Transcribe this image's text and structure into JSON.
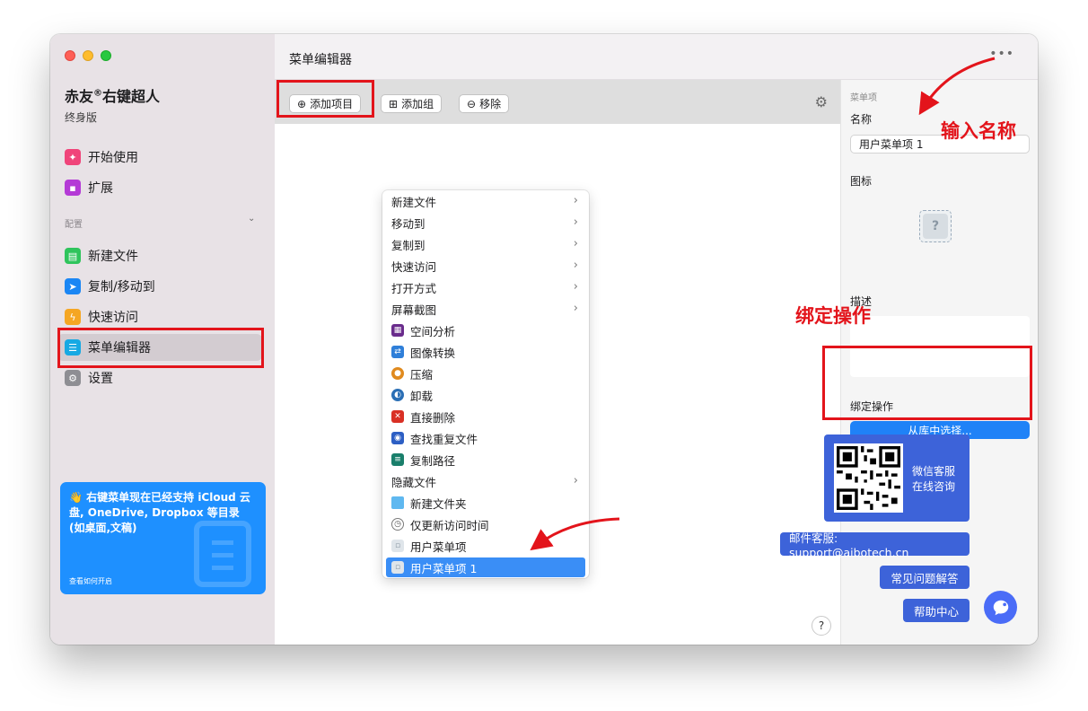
{
  "app": {
    "name": "赤友",
    "registered": "®",
    "name_suffix": "右键超人",
    "edition": "终身版"
  },
  "sidebar": {
    "top_items": [
      {
        "label": "开始使用",
        "icon": "bulb-icon",
        "color": "#f0447a"
      },
      {
        "label": "扩展",
        "icon": "puzzle-icon",
        "color": "#b43ad6"
      }
    ],
    "section_label": "配置",
    "items": [
      {
        "label": "新建文件",
        "icon": "new-file-icon",
        "color": "#2fc45c"
      },
      {
        "label": "复制/移动到",
        "icon": "send-icon",
        "color": "#1b86f4"
      },
      {
        "label": "快速访问",
        "icon": "bolt-icon",
        "color": "#f5a623"
      },
      {
        "label": "菜单编辑器",
        "icon": "list-icon",
        "color": "#17a9e3",
        "active": true
      },
      {
        "label": "设置",
        "icon": "gear-icon",
        "color": "#8e8e93"
      }
    ],
    "promo": {
      "emoji": "👋",
      "text": "右键菜单现在已经支持 iCloud 云盘, OneDrive, Dropbox 等目录 (如桌面,文稿)",
      "link": "查看如何开启"
    }
  },
  "header": {
    "title": "菜单编辑器",
    "more": "•••"
  },
  "toolbar": {
    "add_item": "添加项目",
    "add_group": "添加组",
    "remove": "移除"
  },
  "context_menu": {
    "items": [
      {
        "label": "新建文件",
        "submenu": true
      },
      {
        "label": "移动到",
        "submenu": true
      },
      {
        "label": "复制到",
        "submenu": true
      },
      {
        "label": "快速访问",
        "submenu": true
      },
      {
        "label": "打开方式",
        "submenu": true
      },
      {
        "label": "屏幕截图",
        "submenu": true
      },
      {
        "label": "空间分析",
        "icon": "disk-analyzer-icon",
        "color": "#6a2c8c"
      },
      {
        "label": "图像转换",
        "icon": "image-convert-icon",
        "color": "#2f7fd9"
      },
      {
        "label": "压缩",
        "icon": "archive-icon",
        "color": "#e08a1e"
      },
      {
        "label": "卸载",
        "icon": "uninstall-icon",
        "color": "#2b6fb5"
      },
      {
        "label": "直接删除",
        "icon": "delete-icon",
        "color": "#d93025"
      },
      {
        "label": "查找重复文件",
        "icon": "duplicate-finder-icon",
        "color": "#2d5fc4"
      },
      {
        "label": "复制路径",
        "icon": "copy-path-icon",
        "color": "#1a7f6b"
      },
      {
        "label": "隐藏文件",
        "submenu": true
      },
      {
        "label": "新建文件夹",
        "icon": "folder-icon",
        "color": "#5fb8f0"
      },
      {
        "label": "仅更新访问时间",
        "icon": "clock-icon",
        "color": "#7a7a7a"
      },
      {
        "label": "用户菜单项",
        "icon": "generic-file-icon",
        "color": "#c9d2d9"
      },
      {
        "label": "用户菜单项 1",
        "icon": "generic-file-icon",
        "color": "#c9d2d9",
        "selected": true
      }
    ]
  },
  "inspector": {
    "section": "菜单项",
    "name_label": "名称",
    "name_value": "用户菜单项 1",
    "icon_label": "图标",
    "icon_placeholder": "?",
    "desc_label": "描述",
    "bind_label": "绑定操作",
    "bind_button": "从库中选择..."
  },
  "annotations": {
    "enter_name": "输入名称",
    "bind_action": "绑定操作",
    "accent": "#e3141b"
  },
  "support": {
    "wechat_line1": "微信客服",
    "wechat_line2": "在线咨询",
    "email": "邮件客服: support@aibotech.cn",
    "faq": "常见问题解答",
    "help": "帮助中心",
    "help_q": "?",
    "accent": "#3d63d9"
  }
}
